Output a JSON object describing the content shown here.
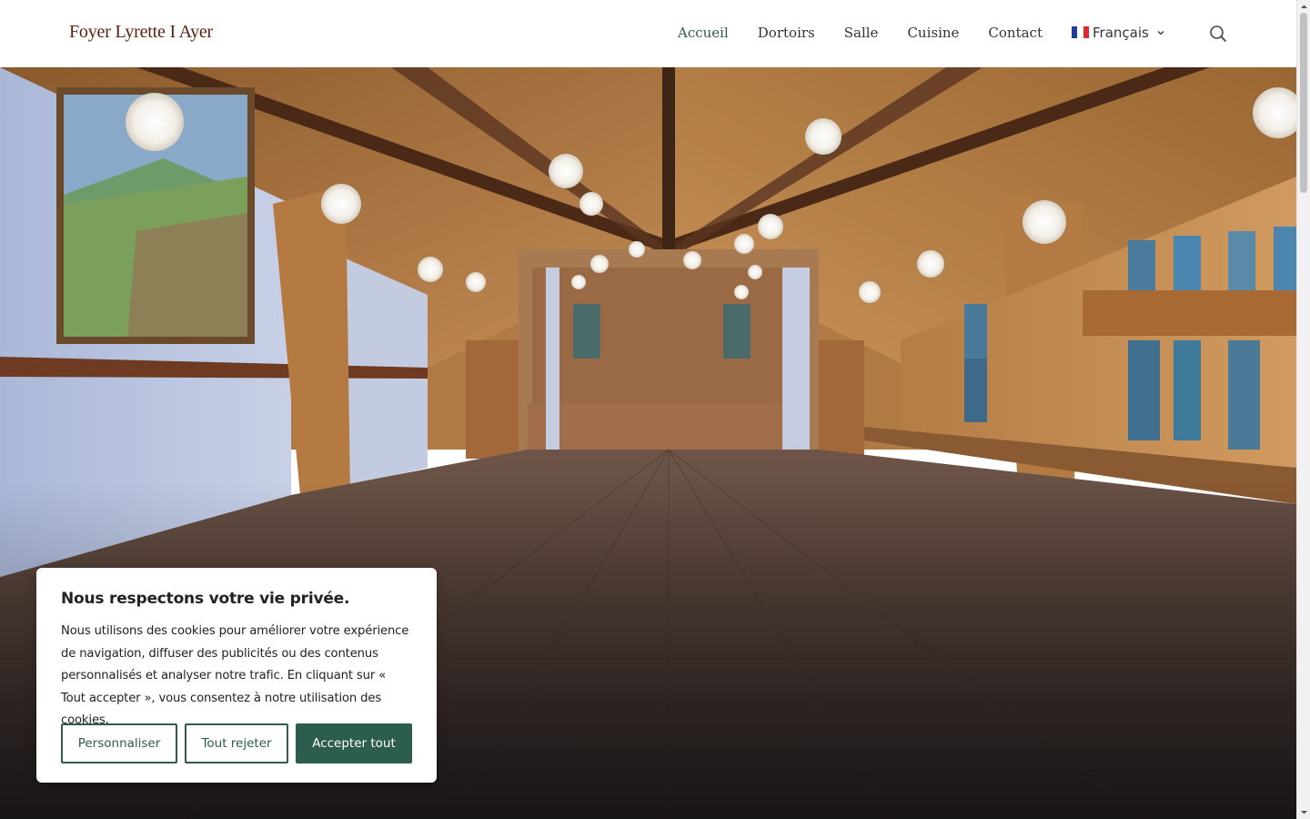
{
  "header": {
    "logo": "Foyer Lyrette I Ayer",
    "nav": [
      {
        "label": "Accueil",
        "active": true
      },
      {
        "label": "Dortoirs",
        "active": false
      },
      {
        "label": "Salle",
        "active": false
      },
      {
        "label": "Cuisine",
        "active": false
      },
      {
        "label": "Contact",
        "active": false
      }
    ],
    "language": {
      "label": "Français",
      "flag": "france-flag-icon"
    },
    "search_icon": "search-icon"
  },
  "cookie_banner": {
    "title": "Nous respectons votre vie privée.",
    "text": "Nous utilisons des cookies pour améliorer votre expérience de navigation, diffuser des publicités ou des contenus personnalisés et analyser notre trafic. En cliquant sur « Tout accepter », vous consentez à notre utilisation des cookies.",
    "buttons": {
      "customize": "Personnaliser",
      "reject": "Tout rejeter",
      "accept": "Accepter tout"
    }
  },
  "colors": {
    "accent": "#2d5d4e",
    "logo": "#5a1f12"
  }
}
